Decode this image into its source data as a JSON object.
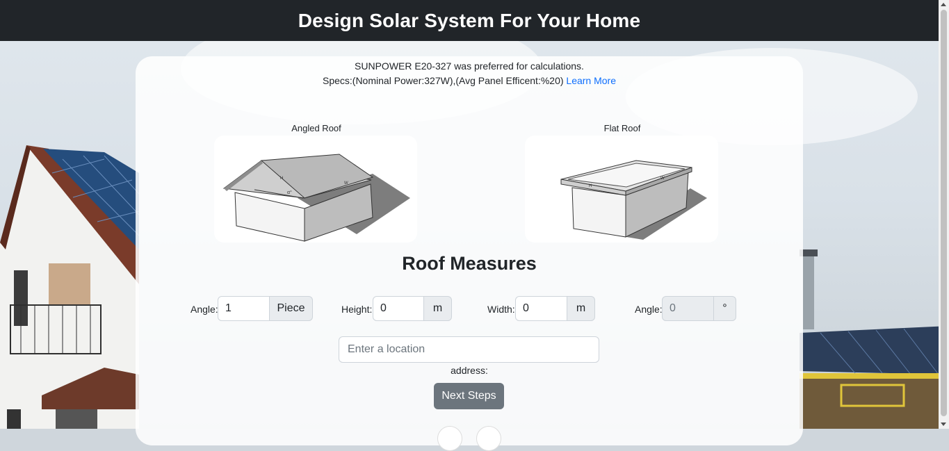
{
  "header": {
    "title": "Design Solar System For Your Home"
  },
  "info": {
    "line1": "SUNPOWER E20-327 was preferred for calculations.",
    "line2": "Specs:(Nominal Power:327W),(Avg Panel Efficent:%20)",
    "learn_more": "Learn More"
  },
  "roofs": {
    "angled": {
      "label": "Angled Roof",
      "marks": {
        "h": "H",
        "w": "W",
        "a": "α°"
      }
    },
    "flat": {
      "label": "Flat Roof",
      "marks": {
        "h": "H",
        "w": "W"
      }
    }
  },
  "section_title": "Roof Measures",
  "form": {
    "panel_count": {
      "label": "Angle:",
      "value": "1",
      "unit": "Piece"
    },
    "height": {
      "label": "Height:",
      "value": "0",
      "unit": "m"
    },
    "width": {
      "label": "Width:",
      "value": "0",
      "unit": "m"
    },
    "angle": {
      "label": "Angle:",
      "value": "0",
      "unit": "°"
    }
  },
  "location": {
    "placeholder": "Enter a location",
    "address_label": "address:"
  },
  "next_button": "Next Steps",
  "colors": {
    "header_bg": "#212529",
    "button_bg": "#6c757d",
    "link": "#0d6efd"
  }
}
